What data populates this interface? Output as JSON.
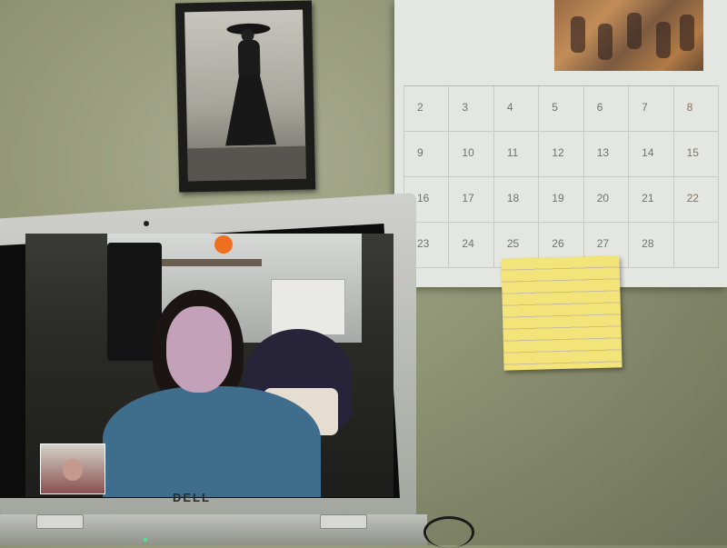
{
  "scene": {
    "description_label": "",
    "laptop": {
      "brand": "DELL"
    },
    "calendar": {
      "weeks": [
        [
          "2",
          "3",
          "4",
          "5",
          "6",
          "7",
          "8"
        ],
        [
          "9",
          "10",
          "11",
          "12",
          "13",
          "14",
          "15"
        ],
        [
          "16",
          "17",
          "18",
          "19",
          "20",
          "21",
          "22"
        ],
        [
          "23",
          "24",
          "25",
          "26",
          "27",
          "28",
          ""
        ]
      ]
    },
    "sticky_note": {
      "lines": []
    },
    "colors": {
      "wall": "#8f9474",
      "sticky": "#f3e47a",
      "shirt": "#3f6d8c"
    }
  }
}
